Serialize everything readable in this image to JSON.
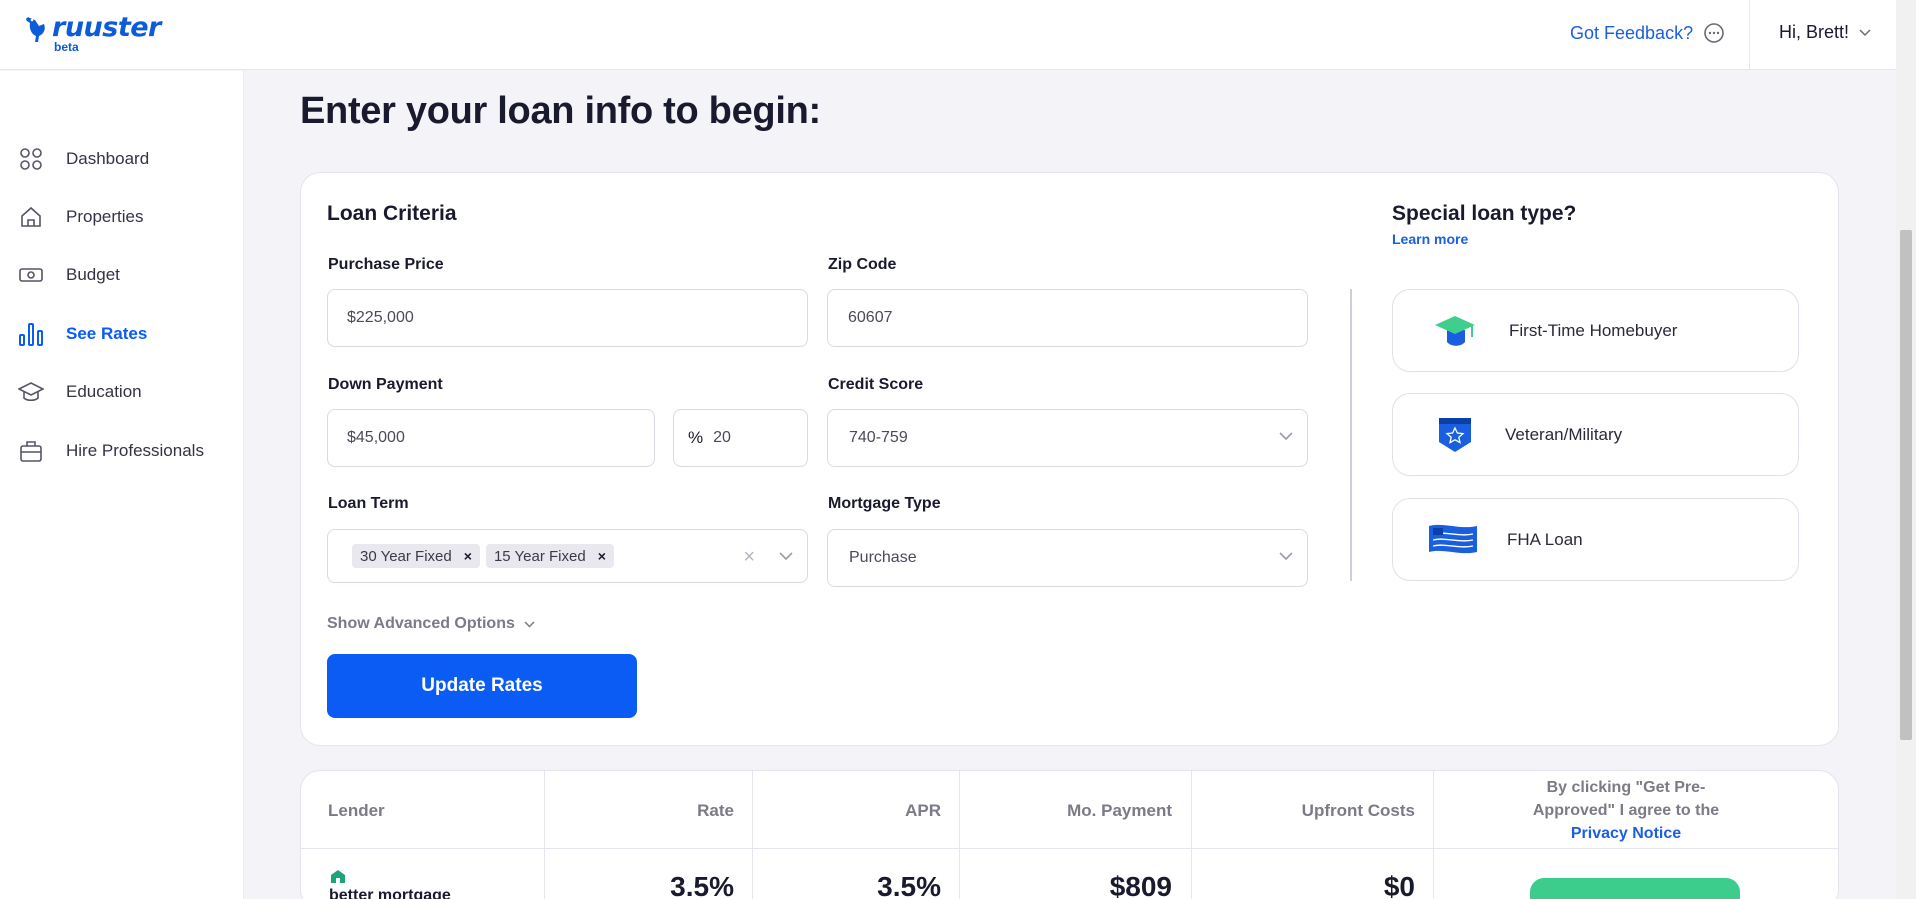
{
  "header": {
    "logo_text": "ruuster",
    "logo_badge": "beta",
    "feedback_label": "Got Feedback?",
    "user_greeting": "Hi, Brett!"
  },
  "sidebar": {
    "items": [
      {
        "label": "Dashboard",
        "icon": "dashboard-icon",
        "active": false
      },
      {
        "label": "Properties",
        "icon": "home-icon",
        "active": false
      },
      {
        "label": "Budget",
        "icon": "cash-icon",
        "active": false
      },
      {
        "label": "See Rates",
        "icon": "bar-chart-icon",
        "active": true
      },
      {
        "label": "Education",
        "icon": "graduation-cap-icon",
        "active": false
      },
      {
        "label": "Hire Professionals",
        "icon": "briefcase-icon",
        "active": false
      }
    ]
  },
  "main": {
    "title": "Enter your loan info to begin:",
    "criteria": {
      "title": "Loan Criteria",
      "purchase_price": {
        "label": "Purchase Price",
        "value": "$225,000"
      },
      "zip_code": {
        "label": "Zip Code",
        "value": "60607"
      },
      "down_payment": {
        "label": "Down Payment",
        "value": "$45,000",
        "percent_symbol": "%",
        "percent_value": "20"
      },
      "credit_score": {
        "label": "Credit Score",
        "value": "740-759"
      },
      "loan_term": {
        "label": "Loan Term",
        "chips": [
          "30 Year Fixed",
          "15 Year Fixed"
        ],
        "chip_remove": "×",
        "clear": "×"
      },
      "mortgage_type": {
        "label": "Mortgage Type",
        "value": "Purchase"
      },
      "advanced_label": "Show Advanced Options",
      "update_button": "Update Rates"
    },
    "special": {
      "title": "Special loan type?",
      "learn_more": "Learn more",
      "types": [
        {
          "label": "First-Time Homebuyer",
          "icon": "graduation-cap-icon"
        },
        {
          "label": "Veteran/Military",
          "icon": "military-badge-icon"
        },
        {
          "label": "FHA Loan",
          "icon": "flag-icon"
        }
      ]
    },
    "rates_table": {
      "headers": {
        "lender": "Lender",
        "rate": "Rate",
        "apr": "APR",
        "payment": "Mo. Payment",
        "upfront": "Upfront Costs"
      },
      "consent": {
        "text": "By clicking \"Get Pre-Approved\" I agree to the",
        "link": "Privacy Notice"
      },
      "rows": [
        {
          "lender": "better mortgage",
          "rate": "3.5%",
          "apr": "3.5%",
          "payment": "$809",
          "upfront": "$0"
        }
      ]
    }
  },
  "colors": {
    "brand_blue": "#0a5cf5",
    "link_blue": "#1a5fe0",
    "cta_green": "#3ccc8c",
    "page_bg": "#f4f3f8"
  }
}
